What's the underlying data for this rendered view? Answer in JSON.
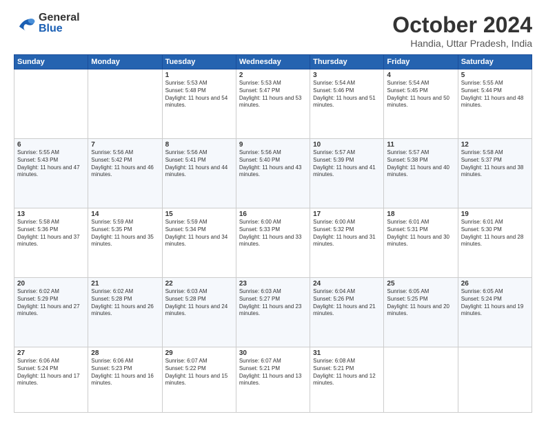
{
  "header": {
    "logo_general": "General",
    "logo_blue": "Blue",
    "month_title": "October 2024",
    "location": "Handia, Uttar Pradesh, India"
  },
  "days_of_week": [
    "Sunday",
    "Monday",
    "Tuesday",
    "Wednesday",
    "Thursday",
    "Friday",
    "Saturday"
  ],
  "weeks": [
    [
      {
        "day": "",
        "sunrise": "",
        "sunset": "",
        "daylight": "",
        "empty": true
      },
      {
        "day": "",
        "sunrise": "",
        "sunset": "",
        "daylight": "",
        "empty": true
      },
      {
        "day": "1",
        "sunrise": "Sunrise: 5:53 AM",
        "sunset": "Sunset: 5:48 PM",
        "daylight": "Daylight: 11 hours and 54 minutes."
      },
      {
        "day": "2",
        "sunrise": "Sunrise: 5:53 AM",
        "sunset": "Sunset: 5:47 PM",
        "daylight": "Daylight: 11 hours and 53 minutes."
      },
      {
        "day": "3",
        "sunrise": "Sunrise: 5:54 AM",
        "sunset": "Sunset: 5:46 PM",
        "daylight": "Daylight: 11 hours and 51 minutes."
      },
      {
        "day": "4",
        "sunrise": "Sunrise: 5:54 AM",
        "sunset": "Sunset: 5:45 PM",
        "daylight": "Daylight: 11 hours and 50 minutes."
      },
      {
        "day": "5",
        "sunrise": "Sunrise: 5:55 AM",
        "sunset": "Sunset: 5:44 PM",
        "daylight": "Daylight: 11 hours and 48 minutes."
      }
    ],
    [
      {
        "day": "6",
        "sunrise": "Sunrise: 5:55 AM",
        "sunset": "Sunset: 5:43 PM",
        "daylight": "Daylight: 11 hours and 47 minutes."
      },
      {
        "day": "7",
        "sunrise": "Sunrise: 5:56 AM",
        "sunset": "Sunset: 5:42 PM",
        "daylight": "Daylight: 11 hours and 46 minutes."
      },
      {
        "day": "8",
        "sunrise": "Sunrise: 5:56 AM",
        "sunset": "Sunset: 5:41 PM",
        "daylight": "Daylight: 11 hours and 44 minutes."
      },
      {
        "day": "9",
        "sunrise": "Sunrise: 5:56 AM",
        "sunset": "Sunset: 5:40 PM",
        "daylight": "Daylight: 11 hours and 43 minutes."
      },
      {
        "day": "10",
        "sunrise": "Sunrise: 5:57 AM",
        "sunset": "Sunset: 5:39 PM",
        "daylight": "Daylight: 11 hours and 41 minutes."
      },
      {
        "day": "11",
        "sunrise": "Sunrise: 5:57 AM",
        "sunset": "Sunset: 5:38 PM",
        "daylight": "Daylight: 11 hours and 40 minutes."
      },
      {
        "day": "12",
        "sunrise": "Sunrise: 5:58 AM",
        "sunset": "Sunset: 5:37 PM",
        "daylight": "Daylight: 11 hours and 38 minutes."
      }
    ],
    [
      {
        "day": "13",
        "sunrise": "Sunrise: 5:58 AM",
        "sunset": "Sunset: 5:36 PM",
        "daylight": "Daylight: 11 hours and 37 minutes."
      },
      {
        "day": "14",
        "sunrise": "Sunrise: 5:59 AM",
        "sunset": "Sunset: 5:35 PM",
        "daylight": "Daylight: 11 hours and 35 minutes."
      },
      {
        "day": "15",
        "sunrise": "Sunrise: 5:59 AM",
        "sunset": "Sunset: 5:34 PM",
        "daylight": "Daylight: 11 hours and 34 minutes."
      },
      {
        "day": "16",
        "sunrise": "Sunrise: 6:00 AM",
        "sunset": "Sunset: 5:33 PM",
        "daylight": "Daylight: 11 hours and 33 minutes."
      },
      {
        "day": "17",
        "sunrise": "Sunrise: 6:00 AM",
        "sunset": "Sunset: 5:32 PM",
        "daylight": "Daylight: 11 hours and 31 minutes."
      },
      {
        "day": "18",
        "sunrise": "Sunrise: 6:01 AM",
        "sunset": "Sunset: 5:31 PM",
        "daylight": "Daylight: 11 hours and 30 minutes."
      },
      {
        "day": "19",
        "sunrise": "Sunrise: 6:01 AM",
        "sunset": "Sunset: 5:30 PM",
        "daylight": "Daylight: 11 hours and 28 minutes."
      }
    ],
    [
      {
        "day": "20",
        "sunrise": "Sunrise: 6:02 AM",
        "sunset": "Sunset: 5:29 PM",
        "daylight": "Daylight: 11 hours and 27 minutes."
      },
      {
        "day": "21",
        "sunrise": "Sunrise: 6:02 AM",
        "sunset": "Sunset: 5:28 PM",
        "daylight": "Daylight: 11 hours and 26 minutes."
      },
      {
        "day": "22",
        "sunrise": "Sunrise: 6:03 AM",
        "sunset": "Sunset: 5:28 PM",
        "daylight": "Daylight: 11 hours and 24 minutes."
      },
      {
        "day": "23",
        "sunrise": "Sunrise: 6:03 AM",
        "sunset": "Sunset: 5:27 PM",
        "daylight": "Daylight: 11 hours and 23 minutes."
      },
      {
        "day": "24",
        "sunrise": "Sunrise: 6:04 AM",
        "sunset": "Sunset: 5:26 PM",
        "daylight": "Daylight: 11 hours and 21 minutes."
      },
      {
        "day": "25",
        "sunrise": "Sunrise: 6:05 AM",
        "sunset": "Sunset: 5:25 PM",
        "daylight": "Daylight: 11 hours and 20 minutes."
      },
      {
        "day": "26",
        "sunrise": "Sunrise: 6:05 AM",
        "sunset": "Sunset: 5:24 PM",
        "daylight": "Daylight: 11 hours and 19 minutes."
      }
    ],
    [
      {
        "day": "27",
        "sunrise": "Sunrise: 6:06 AM",
        "sunset": "Sunset: 5:24 PM",
        "daylight": "Daylight: 11 hours and 17 minutes."
      },
      {
        "day": "28",
        "sunrise": "Sunrise: 6:06 AM",
        "sunset": "Sunset: 5:23 PM",
        "daylight": "Daylight: 11 hours and 16 minutes."
      },
      {
        "day": "29",
        "sunrise": "Sunrise: 6:07 AM",
        "sunset": "Sunset: 5:22 PM",
        "daylight": "Daylight: 11 hours and 15 minutes."
      },
      {
        "day": "30",
        "sunrise": "Sunrise: 6:07 AM",
        "sunset": "Sunset: 5:21 PM",
        "daylight": "Daylight: 11 hours and 13 minutes."
      },
      {
        "day": "31",
        "sunrise": "Sunrise: 6:08 AM",
        "sunset": "Sunset: 5:21 PM",
        "daylight": "Daylight: 11 hours and 12 minutes."
      },
      {
        "day": "",
        "sunrise": "",
        "sunset": "",
        "daylight": "",
        "empty": true
      },
      {
        "day": "",
        "sunrise": "",
        "sunset": "",
        "daylight": "",
        "empty": true
      }
    ]
  ]
}
